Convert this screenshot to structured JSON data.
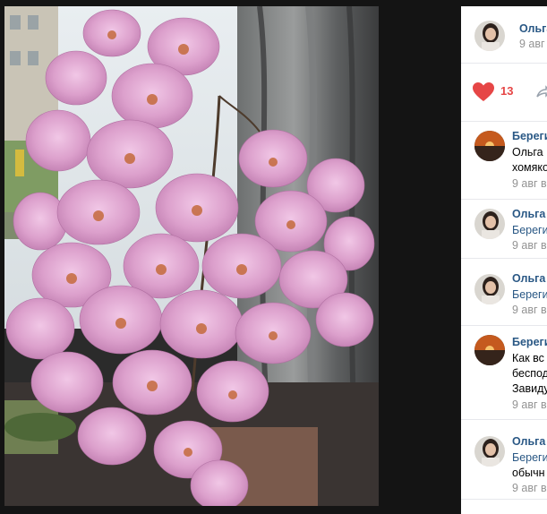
{
  "post": {
    "author": "Ольга",
    "date": "9 авг",
    "likes": "13"
  },
  "comments": [
    {
      "author": "Береги",
      "lines": [
        "Ольга",
        "хомяко"
      ],
      "date": "9 авг в",
      "avatar": "sunset"
    },
    {
      "author": "Ольга С",
      "lines": [
        "Береги"
      ],
      "date": "9 авг в",
      "avatar": "woman"
    },
    {
      "author": "Ольга С",
      "lines": [
        "Береги"
      ],
      "date": "9 авг в",
      "avatar": "woman"
    },
    {
      "author": "Береги",
      "lines": [
        "Как вс",
        "беспод",
        "Завиду"
      ],
      "date": "9 авг в",
      "avatar": "sunset"
    },
    {
      "author": "Ольга С",
      "lines": [
        "Береги",
        "обычн"
      ],
      "date": "9 авг в",
      "avatar": "woman"
    }
  ],
  "colors": {
    "link": "#2a5885",
    "meta": "#939393",
    "like": "#e64646",
    "divider": "#e7e8ec"
  },
  "icons": [
    "heart-icon",
    "share-icon"
  ]
}
